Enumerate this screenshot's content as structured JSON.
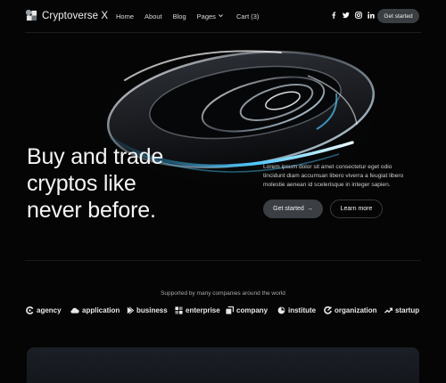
{
  "nav": {
    "brand": "Cryptoverse X",
    "links": {
      "home": "Home",
      "about": "About",
      "blog": "Blog",
      "pages": "Pages",
      "cart": "Cart (3)"
    },
    "social_icons": [
      "facebook-icon",
      "twitter-icon",
      "instagram-icon",
      "linkedin-icon"
    ],
    "cta": "Get started"
  },
  "hero": {
    "headline_lines": [
      "Buy and trade",
      "cryptos like",
      "never before."
    ],
    "description_lines": [
      "Lorem ipsum dolor sit amet consectetur eget odio",
      "tincidunt diam accumsan libero viverra a feugiat libero",
      "molestie aenean id scelerisque in integer sapien."
    ],
    "primary_button": "Get started",
    "primary_arrow": "→",
    "secondary_button": "Learn more"
  },
  "partners": {
    "caption": "Supported by many companies around the world",
    "brands": [
      "agency",
      "application",
      "business",
      "enterprise",
      "company",
      "institute",
      "organization",
      "startup"
    ]
  },
  "colors": {
    "background": "#050505",
    "button_fill": "#3b3e43",
    "accent_glow": "#4fc8ff"
  }
}
